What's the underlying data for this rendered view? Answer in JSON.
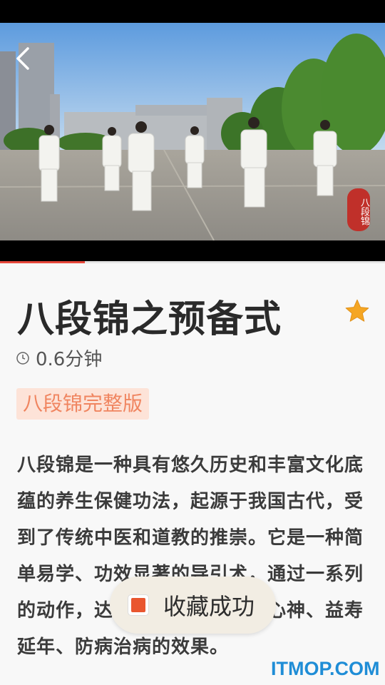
{
  "video": {
    "seal_text": "八段锦",
    "progress_fraction": 0.22
  },
  "lesson": {
    "title": "八段锦之预备式",
    "duration": "0.6分钟",
    "tag": "八段锦完整版",
    "description": "八段锦是一种具有悠久历史和丰富文化底蕴的养生保健功法，起源于我国古代，受到了传统中医和道教的推崇。它是一种简单易学、功效显著的导引术，通过一系列的动作，达到强身健体、怡养心神、益寿延年、防病治病的效果。"
  },
  "toast": {
    "text": "收藏成功"
  },
  "watermark": {
    "text": "ITMOP.COM"
  },
  "icons": {
    "back": "chevron-left-icon",
    "favorite": "star-icon",
    "duration": "clock-icon",
    "toast": "app-icon"
  },
  "colors": {
    "accent": "#e8483b",
    "star": "#f5a623",
    "tag_bg": "#fde3d8",
    "tag_text": "#f08560",
    "watermark": "#1f8dd6"
  }
}
